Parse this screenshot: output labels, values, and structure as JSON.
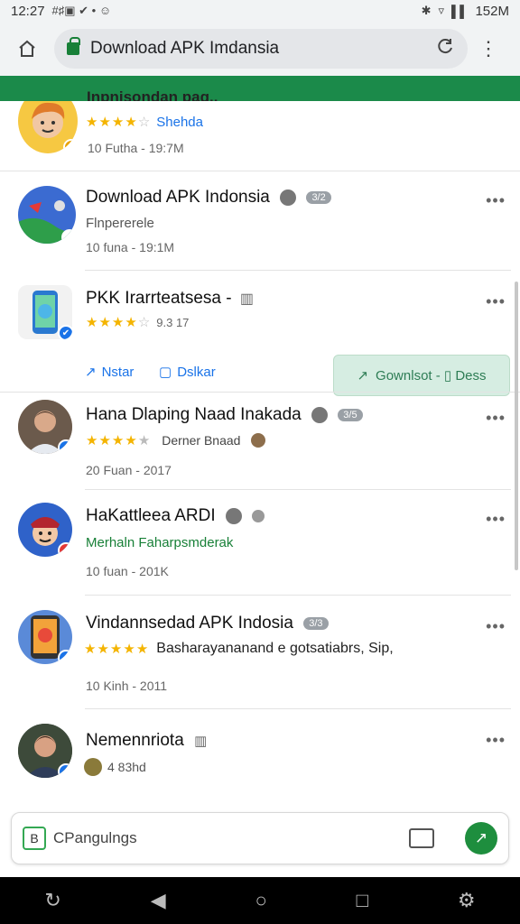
{
  "status_bar": {
    "time": "12:27",
    "left_glyphs": "#♯▣ ✔ • ☺",
    "battery": "152M"
  },
  "browser": {
    "url_text": "Download APK Imdansia"
  },
  "header_partial_title": "Inpnisondan pag..",
  "first_card": {
    "rating_label": "Shehda",
    "meta": "10 Futha - 19:7M",
    "stars": [
      true,
      true,
      true,
      true,
      false
    ]
  },
  "items": [
    {
      "title": "Download APK Indonsia",
      "chip": "3/2",
      "subtitle": "Flnpererele",
      "meta": "10 funa - 19:1M"
    },
    {
      "title": "PKK Irarrteatsesa -",
      "rating_text": "9.3 17",
      "stars": [
        true,
        true,
        true,
        true,
        false
      ],
      "action_left": "Nstar",
      "action_middle": "Dslkar",
      "download_label": "Gownlsot - ▯ Dess"
    },
    {
      "title": "Hana Dlaping Naad Inakada",
      "chip": "3/5",
      "rating_text": "Derner Bnaad",
      "stars": [
        true,
        true,
        true,
        true,
        false
      ],
      "meta": "20 Fuan - 2017"
    },
    {
      "title": "HaKattleea ARDI",
      "subtitle_green": "Merhaln Faharpsmderak",
      "meta": "10 fuan - 201K"
    },
    {
      "title": "Vindannsedad APK Indosia",
      "chip": "3/3",
      "rating_text": "Basharayananand e gotsatiabrs, Sip,",
      "stars": [
        true,
        true,
        true,
        true,
        true
      ],
      "meta": "10 Kinh - 2011"
    },
    {
      "title": "Nemennriota",
      "meta": "4 83hd"
    }
  ],
  "composer": {
    "placeholder": "CPangulngs"
  },
  "colors": {
    "accent_green": "#1b8a4a",
    "link_blue": "#1a73e8",
    "star": "#f4b400"
  },
  "icons": [
    "home-icon",
    "lock-icon",
    "reload-icon",
    "overflow-menu-icon",
    "back-nav-icon",
    "home-nav-icon",
    "recents-nav-icon",
    "settings-icon"
  ]
}
